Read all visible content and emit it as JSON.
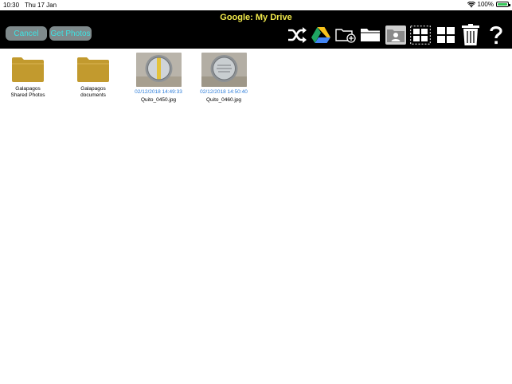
{
  "status": {
    "time": "10:30",
    "date": "Thu 17 Jan",
    "battery": "100%"
  },
  "toolbar": {
    "title": "Google: My Drive",
    "cancel_label": "Cancel",
    "get_photos_label": "Get Photos",
    "tools": [
      "shuffle-icon",
      "google-drive-icon",
      "new-folder-icon",
      "folder-icon",
      "contact-folder-icon",
      "grid-select-icon",
      "grid-icon",
      "trash-icon",
      "help-icon"
    ]
  },
  "items": [
    {
      "type": "folder",
      "label_line1": "Galapagos",
      "label_line2": "Shared Photos"
    },
    {
      "type": "folder",
      "label_line1": "Galapagos",
      "label_line2": "documents"
    },
    {
      "type": "photo",
      "timestamp": "02/12/2018 14:49:33",
      "filename": "Quito_0450.jpg"
    },
    {
      "type": "photo",
      "timestamp": "02/12/2018 14:50:40",
      "filename": "Quito_0460.jpg"
    }
  ],
  "colors": {
    "toolbar_bg": "#000000",
    "title": "#f0e84a",
    "button_bg": "#7f8a8c",
    "button_text": "#3fe3e3",
    "folder": "#c29a2e",
    "timestamp": "#2a7bd8"
  }
}
